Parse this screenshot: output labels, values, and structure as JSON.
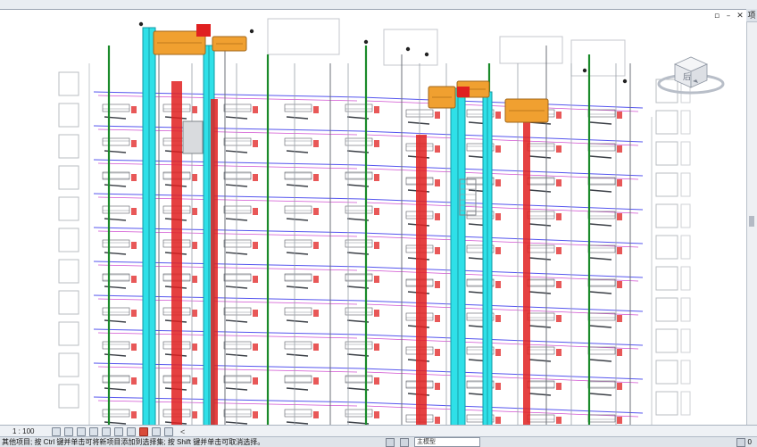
{
  "window": {
    "panel_tab": "项",
    "controls": {
      "restore": "▫",
      "minimize": "–",
      "close": "✕"
    }
  },
  "view_control_bar": {
    "scale": "1 : 100",
    "scroll_left": "<"
  },
  "status_bar": {
    "prompt": "其他项目; 按 Ctrl 键并单击可将新项目添加到选择集; 按 Shift 键并单击可取消选择。",
    "model_label": "主模型",
    "filter_count": "0"
  },
  "view_cube": {
    "face_label": "后"
  },
  "colors": {
    "duct_cyan": "#2fe0e8",
    "equipment_orange": "#f0a030",
    "fire_red": "#e02020",
    "pipe_green": "#1a8a2a",
    "pipe_blue": "#5555ee",
    "pipe_magenta": "#d050d0",
    "building_gray": "#b8bcc2"
  }
}
